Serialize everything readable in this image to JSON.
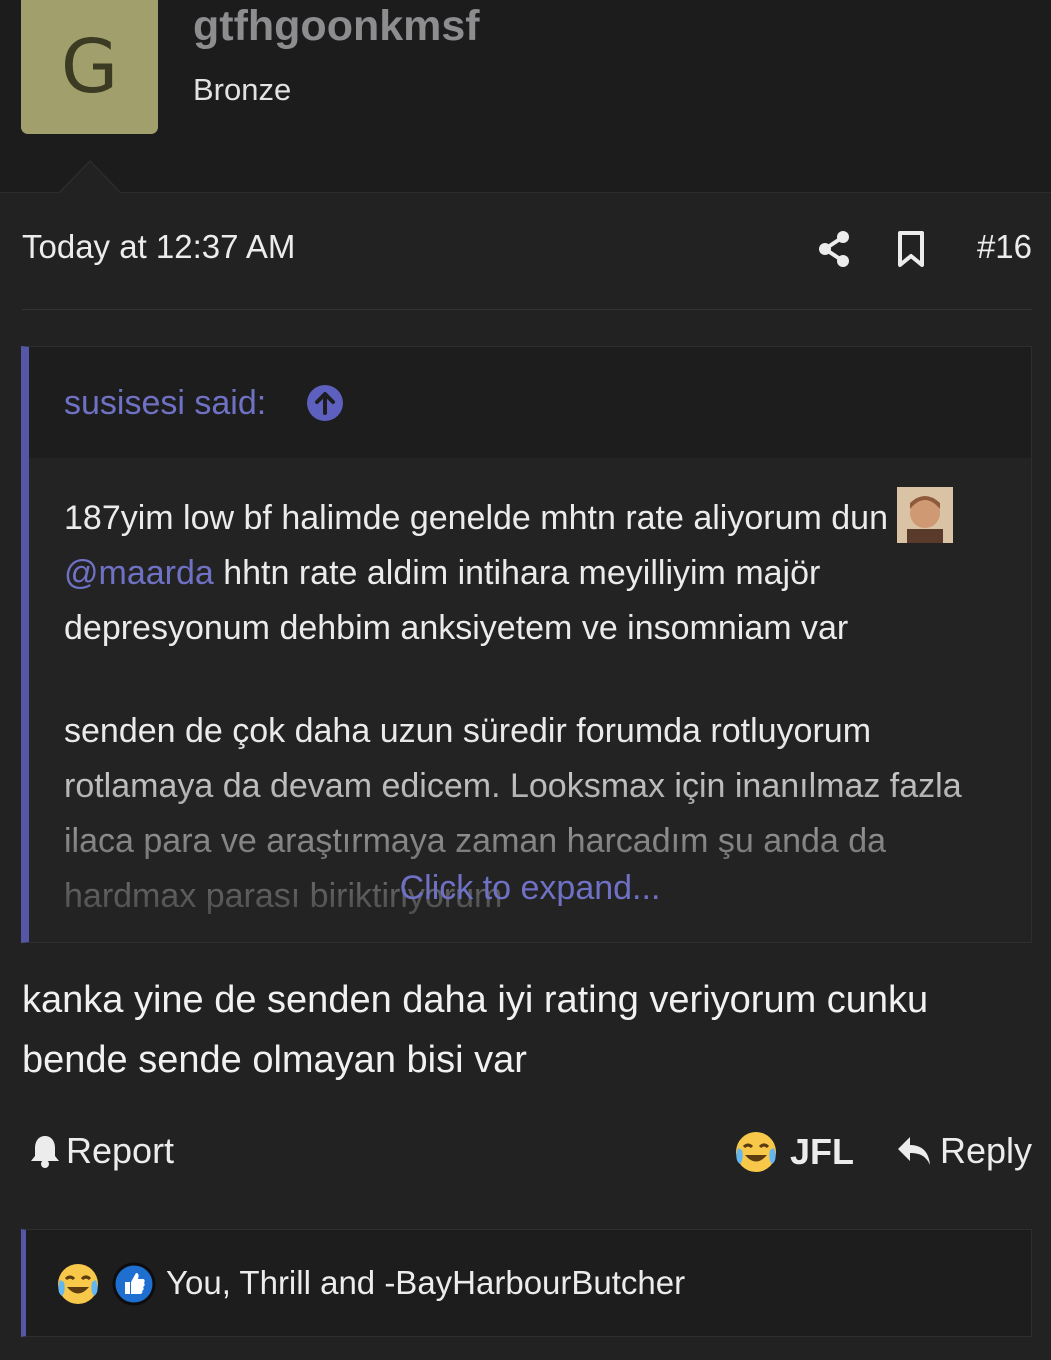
{
  "user": {
    "avatar_letter": "G",
    "username": "gtfhgoonkmsf",
    "title": "Bronze"
  },
  "post": {
    "time": "Today at 12:37 AM",
    "number": "#16",
    "icons": [
      "share-icon",
      "bookmark-icon"
    ]
  },
  "quote": {
    "author": "susisesi said:",
    "para1_a": "187yim low bf halimde genelde mhtn rate aliyorum dun",
    "mention": "@maarda",
    "para1_b": " hhtn rate aldim intihara meyilliyim majör depresyonum dehbim anksiyetem ve insomniam var",
    "para2": "senden de çok daha uzun süredir forumda rotluyorum rotlamaya da devam edicem. Looksmax için inanılmaz fazla ilaca para ve araştırmaya zaman harcadım şu anda da hardmax parası biriktiriyorum",
    "expand": "Click to expand..."
  },
  "message": "kanka yine de senden daha iyi rating veriyorum cunku bende sende olmayan bisi var",
  "actions": {
    "report": "Report",
    "jfl": "JFL",
    "reply": "Reply"
  },
  "reactions": {
    "users": "You, Thrill and -BayHarbourButcher",
    "icons": [
      "crying-laugh-icon",
      "thumbs-up-icon"
    ]
  },
  "colors": {
    "accent": "#5557a6",
    "link": "#6f71c4",
    "background": "#222223",
    "avatar": "#a19f6b"
  }
}
